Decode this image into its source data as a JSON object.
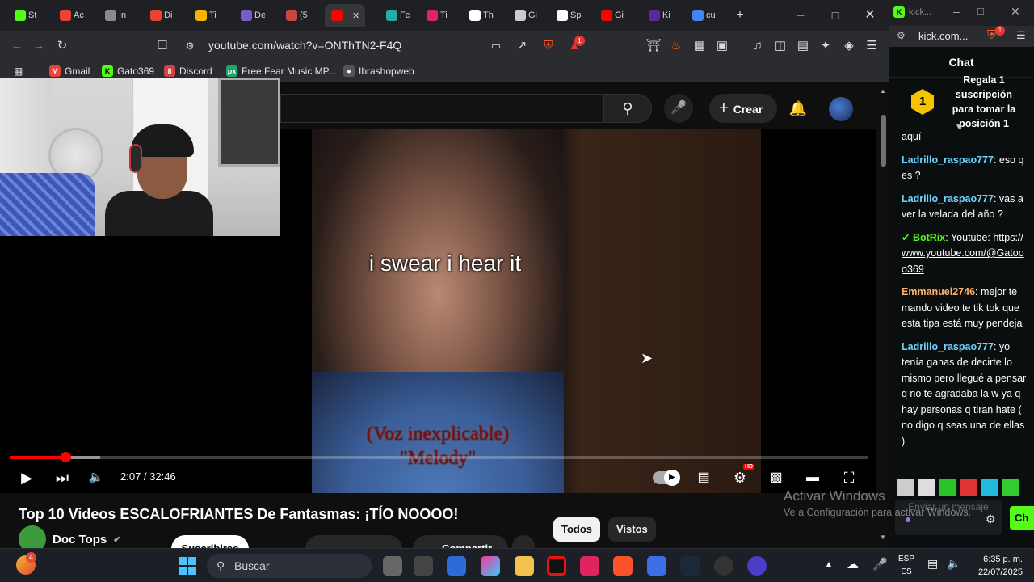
{
  "browser": {
    "tabs": [
      {
        "label": "St",
        "icon": "kick-icon",
        "color": "#53fc18"
      },
      {
        "label": "Ac",
        "icon": "gmail-icon",
        "color": "#ea4335"
      },
      {
        "label": "In",
        "icon": "photo-icon",
        "color": "#8a8a8a"
      },
      {
        "label": "Di",
        "icon": "gmail-icon",
        "color": "#ea4335"
      },
      {
        "label": "Ti",
        "icon": "slides-icon",
        "color": "#f4b400"
      },
      {
        "label": "De",
        "icon": "d-icon",
        "color": "#7a5cc7"
      },
      {
        "label": "(5",
        "icon": "counter-icon",
        "color": "#c44"
      },
      {
        "label": "",
        "icon": "youtube-icon",
        "color": "#ff0000",
        "active": true
      },
      {
        "label": "Fc",
        "icon": "a-icon",
        "color": "#2aa8a8"
      },
      {
        "label": "Ti",
        "icon": "t-icon",
        "color": "#e0245e"
      },
      {
        "label": "Th",
        "icon": "diamond-icon",
        "color": "#ffffff"
      },
      {
        "label": "Gi",
        "icon": "openai-icon",
        "color": "#cccccc"
      },
      {
        "label": "Sp",
        "icon": "github-icon",
        "color": "#ffffff"
      },
      {
        "label": "Gi",
        "icon": "youtube-icon",
        "color": "#ff0000"
      },
      {
        "label": "Ki",
        "icon": "circle-icon",
        "color": "#5a2a9a"
      },
      {
        "label": "cu",
        "icon": "google-icon",
        "color": "#4285f4"
      }
    ],
    "url": "youtube.com/watch?v=ONThTN2-F4Q",
    "bookmarks": [
      "Gmail",
      "Gato369",
      "Discord",
      "Free Fear Music MP...",
      "Ibrashopweb"
    ],
    "notification_badge": "1"
  },
  "youtube": {
    "create_label": "Crear",
    "caption_top": "i swear i hear it",
    "caption_bottom_line1": "(Voz inexplicable)",
    "caption_bottom_line2": "\"Melody\"",
    "time": "2:07 / 32:46",
    "progress_fraction": 0.065,
    "buffer_fraction": 0.105,
    "hd_badge": "HD",
    "video_title": "Top 10 Videos ESCALOFRIANTES De Fantasmas: ¡TÍO NOOOO!",
    "channel_name": "Doc Tops",
    "subscribe_label": "Suscribirse",
    "share_label": "Compartir",
    "chips": [
      "Todos",
      "Vistos"
    ]
  },
  "kick": {
    "tab_label": "kick...",
    "url": "kick.com...",
    "badge": "1",
    "chat_title": "Chat",
    "pinned_rank": "1",
    "pinned_text": "Regala 1 suscripción para tomar la posición 1",
    "messages": [
      {
        "user": "",
        "text": "aquí",
        "user_color": "#ffffff"
      },
      {
        "user": "Ladrillo_raspao777",
        "text": "eso q es ?",
        "user_color": "#6bd6ff"
      },
      {
        "user": "Ladrillo_raspao777",
        "text": "vas a ver la velada del año ?",
        "user_color": "#6bd6ff"
      },
      {
        "user": "BotRix",
        "text": "Youtube: ",
        "link": "https://www.youtube.com/@Gatooo369",
        "user_color": "#53fc18",
        "bot": true
      },
      {
        "user": "Emmanuel2746",
        "text": "mejor te mando video te tik tok que esta tipa está muy pendeja",
        "user_color": "#ffb36b"
      },
      {
        "user": "Ladrillo_raspao777",
        "text": "yo tenía ganas de decirte lo mismo pero llegué a pensar q no te agradaba la w ya q hay personas q tiran hate ( no digo q seas una de ellas )",
        "user_color": "#6bd6ff"
      }
    ],
    "input_placeholder": "Enviar un mensaje",
    "send_label": "Ch"
  },
  "watermark": {
    "line1": "Activar Windows",
    "line2": "Ve a Configuración para activar Windows."
  },
  "taskbar": {
    "search_placeholder": "Buscar",
    "notification_count": "4",
    "language": "ESP",
    "language_sub": "ES",
    "time": "6:35 p. m.",
    "date": "22/07/2025"
  }
}
